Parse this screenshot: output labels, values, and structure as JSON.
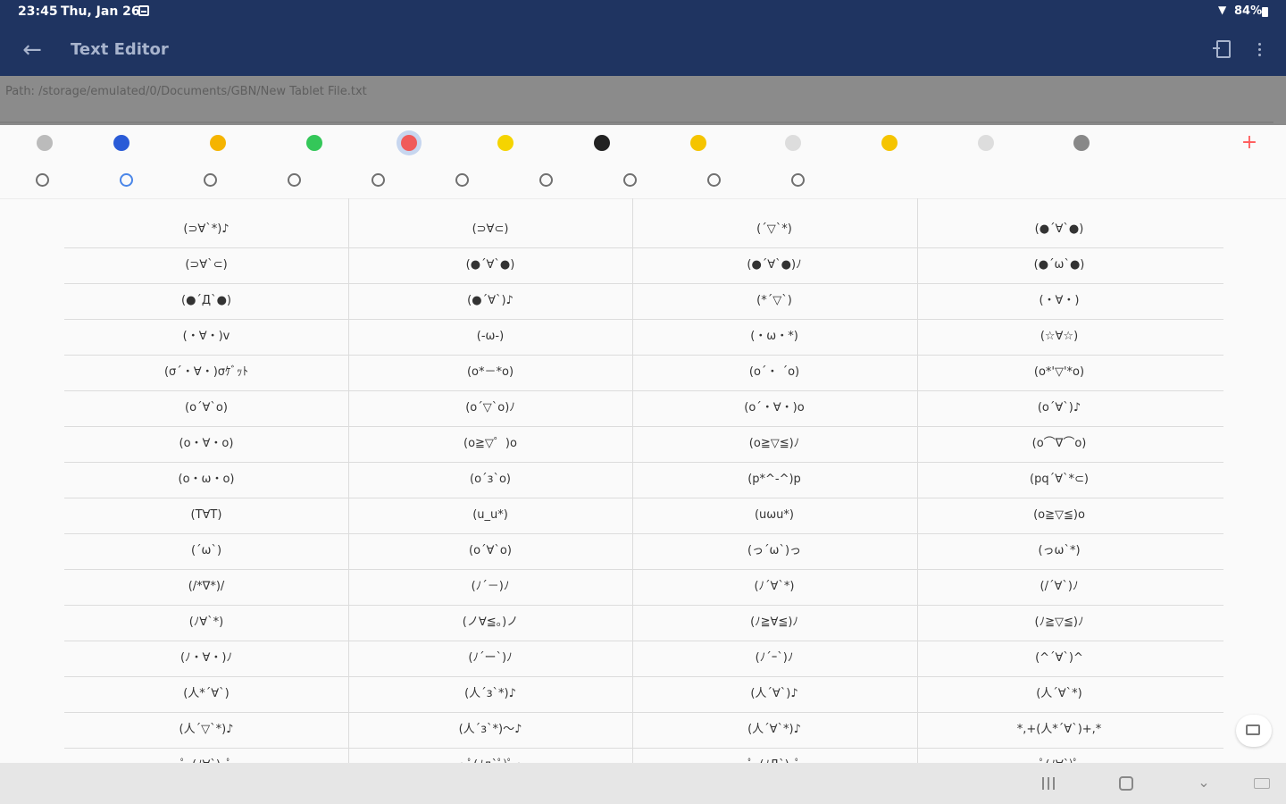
{
  "status_bar": {
    "time": "23:45",
    "date": "Thu, Jan 26",
    "battery": "84%"
  },
  "app_bar": {
    "title": "Text Editor",
    "back_icon": "arrow-left-icon",
    "doc_icon": "document-icon",
    "more_icon": "more-vert-icon"
  },
  "path": "Path: /storage/emulated/0/Documents/GBN/New Tablet File.txt",
  "emoji_tabs": [
    {
      "icon": "keyboard-icon",
      "color": "#bbbbbb"
    },
    {
      "icon": "home-icon",
      "color": "#2a5bd7"
    },
    {
      "icon": "grinning-face-icon",
      "color": "#f5b400"
    },
    {
      "icon": "speech-bubble-icon",
      "color": "#34c759"
    },
    {
      "icon": "cat-face-icon",
      "color": "#f05a5a"
    },
    {
      "icon": "sparkle-icon",
      "color": "#f5d400"
    },
    {
      "icon": "person-icon",
      "color": "#222222"
    },
    {
      "icon": "peanut-icon",
      "color": "#f5c400"
    },
    {
      "icon": "circle-outline-icon",
      "color": "#dddddd"
    },
    {
      "icon": "bell-icon",
      "color": "#f5c400"
    },
    {
      "icon": "rabbit-face-icon",
      "color": "#dddddd"
    },
    {
      "icon": "settings-gear-icon",
      "color": "#888888"
    }
  ],
  "subcategory_tabs": [
    "clock-icon",
    "emoticon-happy-icon",
    "emoticon-icon",
    "emoticon-icon",
    "emoticon-icon",
    "emoticon-icon",
    "emoticon-face-icon",
    "emoticon-icon",
    "emoticon-icon",
    "emoticon-icon"
  ],
  "kaomoji_rows": [
    [
      "(⊃∀`*)♪",
      "(⊃∀⊂)",
      "(´▽`*)",
      "(●´∀`●)"
    ],
    [
      "(⊃∀`⊂)",
      "(●´∀`●)",
      "(●´∀`●)ﾉ",
      "(●´ω`●)"
    ],
    [
      "(●´Д`●)",
      "(●´∀`)♪",
      "(*´▽`)",
      "(・∀・)"
    ],
    [
      "(・∀・)v",
      "(-ω-)",
      "(・ω・*)",
      "(☆∀☆)"
    ],
    [
      "(σ´・∀・)σｹﾞｯﾄ",
      "(o*－*o)",
      "(o´・ ´o)",
      "(o*'▽'*o)"
    ],
    [
      "(o´∀`o)",
      "(o´▽`o)ﾉ",
      "(o´・∀・)o",
      "(o´∀`)♪"
    ],
    [
      "(o・∀・o)",
      "(o≧▽゜)o",
      "(o≧▽≦)ﾉ",
      "(o⌒∇⌒o)"
    ],
    [
      "(o・ω・o)",
      "(o´з`o)",
      "(p*^-^)p",
      "(pq´∀`*⊂)"
    ],
    [
      "(T∀T)",
      "(u_u*)",
      "(uωu*)",
      "(o≧▽≦)o"
    ],
    [
      "(´ω`)",
      "(o´∀`o)",
      "(っ´ω`)っ",
      "(っω`*)"
    ],
    [
      "(/*∇*)/",
      "(ﾉ´－)ﾉ",
      "(ﾉ´∀`*)",
      "(/´∀`)ﾉ"
    ],
    [
      "(ﾉ∀`*)",
      "(ノ∀≦。)ノ",
      "(ﾉ≧∀≦)ﾉ",
      "(ﾉ≧▽≦)ﾉ"
    ],
    [
      "(ﾉ・∀・)ﾉ",
      "(ﾉ´ー`)ﾉ",
      "(ﾉ´ｰ`)ﾉ",
      "(^´∀`)^"
    ],
    [
      "(人*´∀`)",
      "(人´з`*)♪",
      "(人´∀`)♪",
      "(人´∀`*)"
    ],
    [
      "(人´▽`*)♪",
      "(人´з`*)〜♪",
      "(人´∀`*)♪",
      "*,+(人*´∀`)+,*"
    ],
    [
      "･ﾟ･(ﾉ∀`)･ﾟ･",
      "・ﾟ(ﾉд`ﾟ)ﾟ・",
      "･ﾟ･(ﾉД`)･ﾟ･",
      "･ﾟ(ﾉ∀`)ﾟ･"
    ]
  ],
  "nav_bar": [
    "recent-apps-icon",
    "home-square-icon",
    "chevron-down-icon",
    "keyboard-icon"
  ]
}
